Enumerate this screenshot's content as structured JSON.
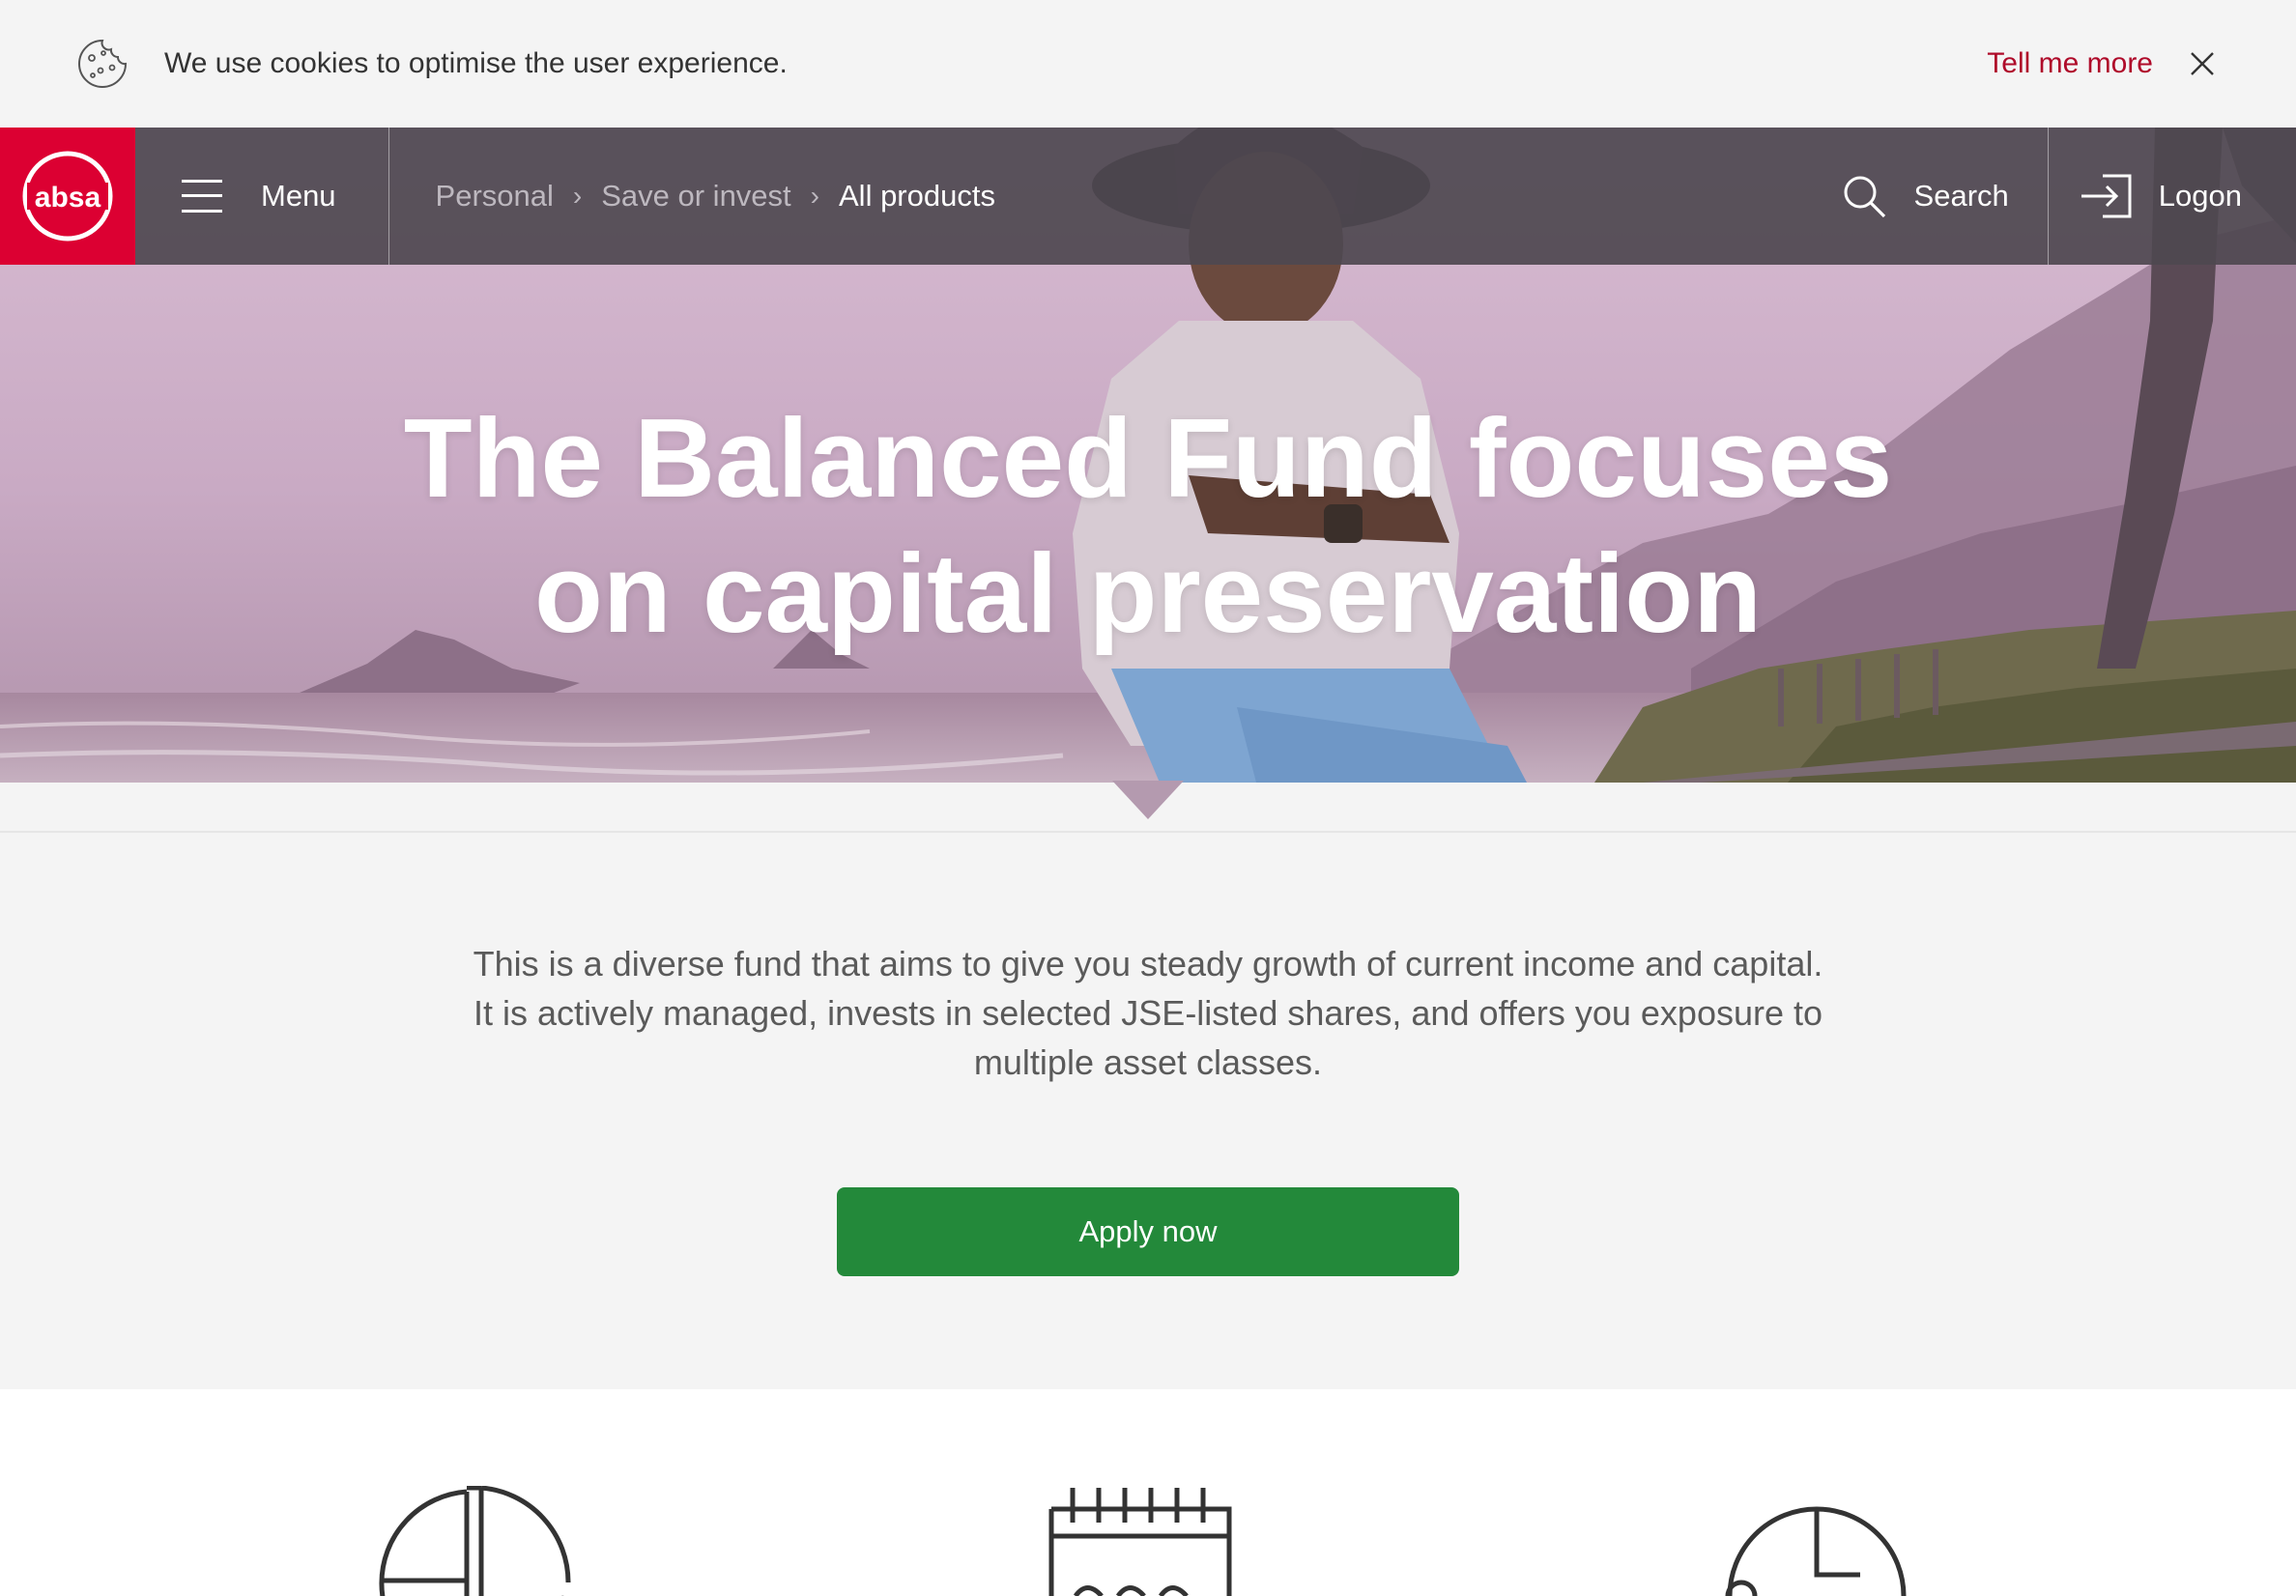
{
  "cookie": {
    "text": "We use cookies to optimise the user experience.",
    "link": "Tell me more"
  },
  "nav": {
    "logo_text": "absa",
    "menu_label": "Menu",
    "breadcrumb": [
      "Personal",
      "Save or invest",
      "All products"
    ],
    "search_label": "Search",
    "logon_label": "Logon"
  },
  "hero": {
    "title_line1": "The Balanced Fund focuses",
    "title_line2": "on capital preservation"
  },
  "intro": {
    "line1": "This is a diverse fund that aims to give you steady growth of current income and capital.",
    "line2": "It is actively managed, invests in selected JSE-listed shares, and offers you exposure to",
    "line3": "multiple asset classes."
  },
  "cta": {
    "label": "Apply now"
  },
  "features": {
    "icons": [
      "pie-chart-icon",
      "calendar-icon",
      "clock-icon"
    ]
  },
  "colors": {
    "brand_red": "#dc0032",
    "link_red": "#af0b2a",
    "cta_green": "#23893a",
    "nav_bg": "#4e4850"
  }
}
